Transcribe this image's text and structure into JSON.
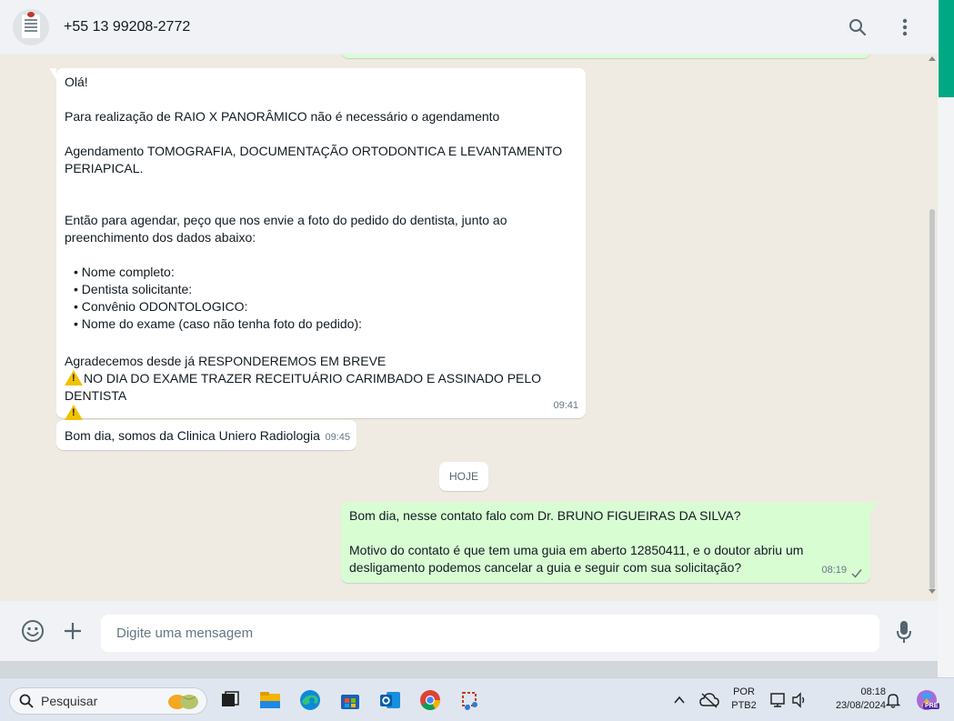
{
  "header": {
    "contact_name": "+55 13 99208-2772",
    "search_icon": "search-icon",
    "menu_icon": "more-vertical-icon"
  },
  "messages": {
    "incoming_1": {
      "lines": [
        "Olá!",
        "",
        "Para realização de RAIO X PANORÂMICO não é necessário o agendamento",
        "",
        "Agendamento TOMOGRAFIA, DOCUMENTAÇÃO ORTODONTICA E LEVANTAMENTO",
        "PERIAPICAL.",
        "",
        "",
        "Então para agendar, peço que nos envie a foto do pedido do dentista, junto ao",
        "preenchimento dos dados abaixo:"
      ],
      "bullets": [
        "Nome completo:",
        "Dentista solicitante:",
        "Convênio ODONTOLOGICO:",
        "Nome do exame (caso não tenha foto do pedido):"
      ],
      "closing": "Agradecemos desde já RESPONDEREMOS EM BREVE",
      "warning": "NO DIA DO EXAME TRAZER RECEITUÁRIO CARIMBADO E ASSINADO PELO DENTISTA",
      "time": "09:41"
    },
    "incoming_2": {
      "text": "Bom dia, somos da Clinica Uniero Radiologia",
      "time": "09:45"
    },
    "date_divider": "HOJE",
    "outgoing_1": {
      "line1": "Bom dia, nesse contato falo com Dr. BRUNO FIGUEIRAS DA SILVA?",
      "line2": "Motivo do contato é que tem uma guia em aberto 12850411, e o doutor abriu um",
      "line3": "desligamento podemos cancelar a guia e seguir com sua solicitação?",
      "time": "08:19",
      "status_icon": "single-check-icon"
    }
  },
  "compose": {
    "placeholder": "Digite uma mensagem",
    "emoji_icon": "emoji-icon",
    "attach_icon": "plus-icon",
    "mic_icon": "microphone-icon"
  },
  "taskbar": {
    "search_label": "Pesquisar",
    "lang_line1": "POR",
    "lang_line2": "PTB2",
    "time": "08:18",
    "date": "23/08/2024",
    "copilot_badge": "PRE"
  },
  "colors": {
    "accent": "#00a884",
    "outgoing_bubble": "#d9fdd3",
    "incoming_bubble": "#ffffff",
    "chat_bg": "#efeae2"
  }
}
